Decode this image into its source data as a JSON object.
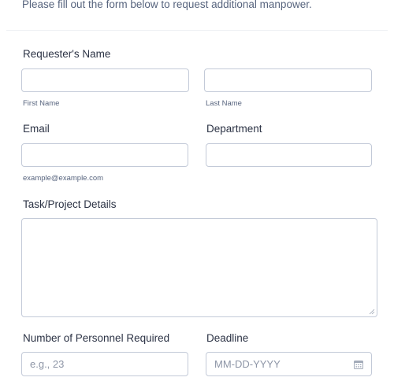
{
  "intro_text": "Please fill out the form below to request additional manpower.",
  "requester": {
    "label": "Requester's Name",
    "first_name_sublabel": "First Name",
    "last_name_sublabel": "Last Name",
    "first_name_value": "",
    "last_name_value": ""
  },
  "email": {
    "label": "Email",
    "sublabel": "example@example.com",
    "value": ""
  },
  "department": {
    "label": "Department",
    "value": ""
  },
  "task": {
    "label": "Task/Project Details",
    "value": ""
  },
  "personnel": {
    "label": "Number of Personnel Required",
    "placeholder": "e.g., 23"
  },
  "deadline": {
    "label": "Deadline",
    "placeholder": "MM-DD-YYYY",
    "icon": "calendar-icon"
  },
  "colors": {
    "text": "#2c3345",
    "sublabel": "#57647e",
    "border": "#c3cad8",
    "placeholder": "#8d95a6"
  }
}
